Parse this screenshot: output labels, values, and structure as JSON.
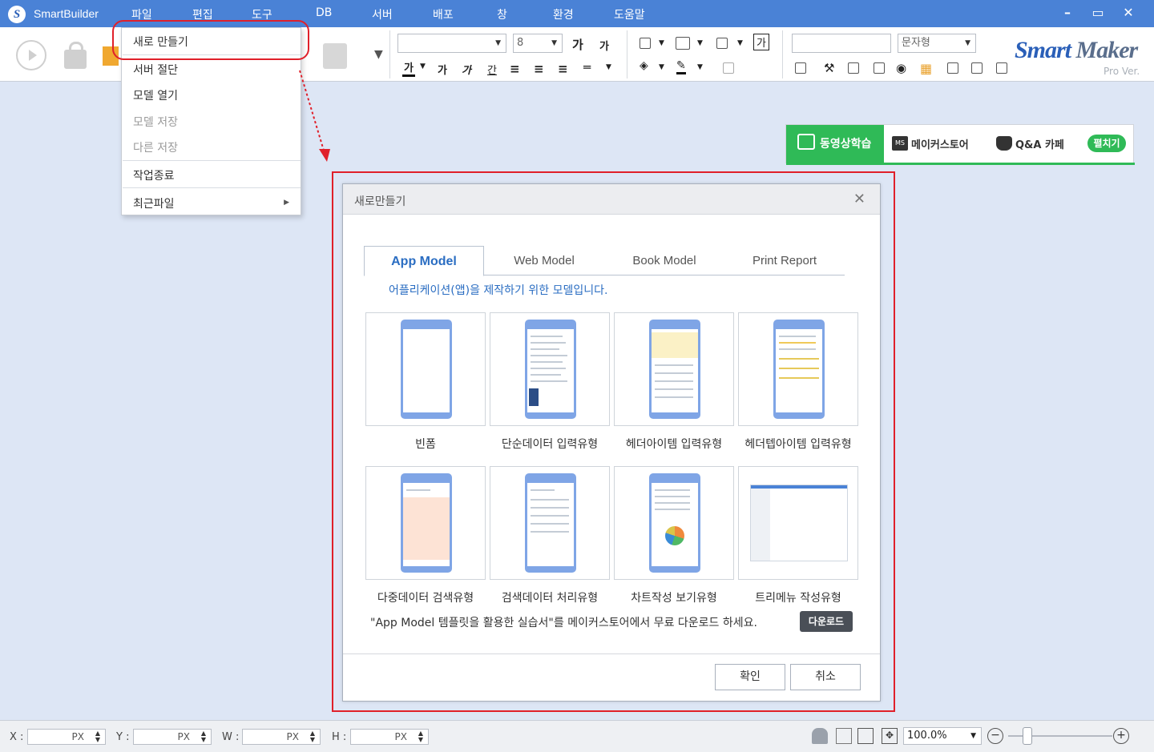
{
  "titlebar": {
    "app_name": "SmartBuilder",
    "logo_letter": "S",
    "menus": [
      "파일",
      "편집",
      "도구",
      "DB",
      "서버",
      "배포",
      "창",
      "환경",
      "도움말"
    ],
    "minimize": "–",
    "maximize": "▭",
    "close": "✕"
  },
  "toolbar": {
    "font_name": "",
    "font_size": "8",
    "style_value": "",
    "style_select": "문자형",
    "btn_grow": "가",
    "btn_shrink": "가",
    "btn_fontcolor": "가",
    "btn_bold": "가",
    "btn_italic": "가",
    "btn_underline": "간",
    "btn_preview": "가",
    "brand": "Smart",
    "brand2": "Maker",
    "brand_sub": "Pro Ver."
  },
  "file_menu": {
    "items": [
      "새로 만들기",
      "서버 절단",
      "모델 열기",
      "모델 저장",
      "다른 저장",
      "작업종료",
      "최근파일"
    ]
  },
  "promo": {
    "video": "동영상학습",
    "store": "메이커스토어",
    "qa": "Q&A 카페",
    "expand": "펼치기",
    "store_icon_text": "MS"
  },
  "dialog": {
    "title": "새로만들기",
    "close": "✕",
    "tabs": [
      "App Model",
      "Web Model",
      "Book Model",
      "Print Report"
    ],
    "description": "어플리케이션(앱)을 제작하기 위한 모델입니다.",
    "templates": [
      "빈폼",
      "단순데이터 입력유형",
      "헤더아이템 입력유형",
      "헤더텝아이템 입력유형",
      "다중데이터 검색유형",
      "검색데이터 처리유형",
      "차트작성 보기유형",
      "트리메뉴 작성유형"
    ],
    "note": "\"App Model 템플릿을 활용한 실습서\"를 메이커스토어에서 무료 다운로드 하세요.",
    "download": "다운로드",
    "ok": "확인",
    "cancel": "취소"
  },
  "statusbar": {
    "x_label": "X :",
    "y_label": "Y :",
    "w_label": "W :",
    "h_label": "H :",
    "unit": "PX",
    "zoom": "100.0%",
    "zoom_out": "−",
    "zoom_in": "+"
  },
  "colors": {
    "title_blue": "#4a82d6",
    "highlight_red": "#e0202a",
    "promo_green": "#2fba57",
    "tab_active": "#2a6dc2"
  }
}
